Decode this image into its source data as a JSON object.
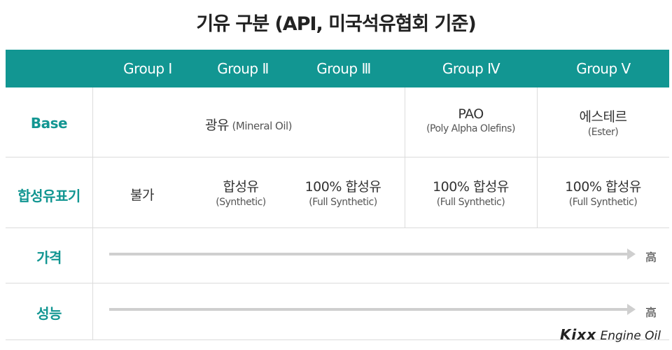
{
  "title": "기유 구분 (API, 미국석유협회 기준)",
  "colors": {
    "header_bg": "#129692",
    "label_text": "#129692",
    "arrow": "#cfcfcf"
  },
  "header": [
    "Group Ⅰ",
    "Group Ⅱ",
    "Group Ⅲ",
    "Group Ⅳ",
    "Group Ⅴ"
  ],
  "rows": {
    "base": {
      "label": "Base",
      "mineral": {
        "main": "광유",
        "sub": "(Mineral Oil)"
      },
      "pao": {
        "main": "PAO",
        "sub": "(Poly Alpha Olefins)"
      },
      "ester": {
        "main": "에스테르",
        "sub": "(Ester)"
      }
    },
    "synthetic": {
      "label": "합성유표기",
      "cells": [
        {
          "main": "불가",
          "sub": ""
        },
        {
          "main": "합성유",
          "sub": "(Synthetic)"
        },
        {
          "main": "100% 합성유",
          "sub": "(Full Synthetic)"
        },
        {
          "main": "100% 합성유",
          "sub": "(Full Synthetic)"
        },
        {
          "main": "100% 합성유",
          "sub": "(Full Synthetic)"
        }
      ]
    },
    "price": {
      "label": "가격",
      "high_label": "高"
    },
    "performance": {
      "label": "성능",
      "high_label": "高"
    }
  },
  "logo": {
    "brand": "Kixx",
    "tagline": "Engine Oil"
  }
}
